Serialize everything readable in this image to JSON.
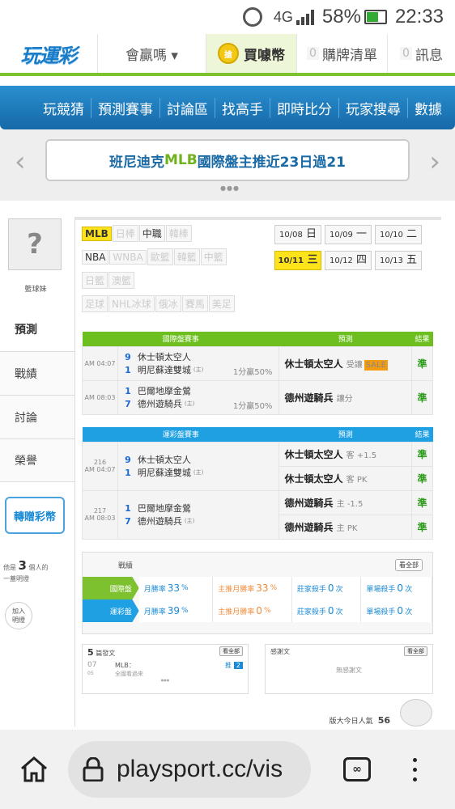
{
  "status": {
    "battery": "58%",
    "time": "22:33",
    "network": "4G"
  },
  "nav": {
    "logo": "玩運彩",
    "user_menu": "會贏嗎 ▾",
    "buy": "買噱幣",
    "coin_icon": "搶",
    "buy_list_count": "0",
    "buy_list": "購牌清單",
    "msg_count": "0",
    "messages": "訊息"
  },
  "main_nav": [
    "玩競猜",
    "預測賽事",
    "討論區",
    "找高手",
    "即時比分",
    "玩家搜尋",
    "數據"
  ],
  "carousel": {
    "left_arrow": "‹",
    "right_arrow": "›",
    "text_a": "班尼迪克 ",
    "text_b": "MLB",
    "text_c": " 國際盤主推近23日過21",
    "dots": "●●●"
  },
  "profile": {
    "avatar_mark": "?",
    "username": "籃球妹"
  },
  "side_tabs": [
    "預測",
    "戰績",
    "討論",
    "榮譽"
  ],
  "gift_button": "轉贈彩幣",
  "fans": {
    "pre": "他是",
    "count": "3",
    "post": "個人的",
    "line2": "一蓋明燈"
  },
  "follow": {
    "line1": "加入",
    "line2": "明燈"
  },
  "sports": [
    {
      "label": "MLB",
      "state": "on"
    },
    {
      "label": "日棒",
      "state": "dim"
    },
    {
      "label": "中職",
      "state": "norm"
    },
    {
      "label": "韓棒",
      "state": "dim"
    },
    {
      "label": "NBA",
      "state": "norm"
    },
    {
      "label": "WNBA",
      "state": "dim"
    },
    {
      "label": "歐籃",
      "state": "dim"
    },
    {
      "label": "韓籃",
      "state": "dim"
    },
    {
      "label": "中籃",
      "state": "dim"
    },
    {
      "label": "日籃",
      "state": "dim"
    },
    {
      "label": "澳籃",
      "state": "dim"
    },
    {
      "label": "足球",
      "state": "dim"
    },
    {
      "label": "NHL冰球",
      "state": "dim"
    },
    {
      "label": "俄冰",
      "state": "dim"
    },
    {
      "label": "賽馬",
      "state": "dim"
    },
    {
      "label": "美足",
      "state": "dim"
    }
  ],
  "dates": [
    {
      "d": "10/08",
      "w": "日",
      "on": false
    },
    {
      "d": "10/09",
      "w": "一",
      "on": false
    },
    {
      "d": "10/10",
      "w": "二",
      "on": false
    },
    {
      "d": "10/11",
      "w": "三",
      "on": true
    },
    {
      "d": "10/12",
      "w": "四",
      "on": false
    },
    {
      "d": "10/13",
      "w": "五",
      "on": false
    }
  ],
  "intl_table": {
    "headers": [
      "國際盤賽事",
      "預測",
      "結果"
    ],
    "rows": [
      {
        "time": "AM 04:07",
        "n1": "9",
        "t1": "休士頓太空人",
        "n2": "1",
        "t2": "明尼蘇達雙城",
        "host": "(主)",
        "odds": "1分贏50%",
        "pick": "休士頓太空人",
        "type": "受讓",
        "badge": "SALE",
        "result": "準"
      },
      {
        "time": "AM 08:03",
        "n1": "1",
        "t1": "巴爾地摩金鶯",
        "n2": "7",
        "t2": "德州遊騎兵",
        "host": "(主)",
        "odds": "1分贏50%",
        "pick": "德州遊騎兵",
        "type": "讓分",
        "badge": "",
        "result": "準"
      }
    ]
  },
  "lottery_table": {
    "headers": [
      "運彩盤賽事",
      "預測",
      "結果"
    ],
    "games": [
      {
        "id": "216",
        "time": "AM 04:07",
        "n1": "9",
        "t1": "休士頓太空人",
        "n2": "1",
        "t2": "明尼蘇達雙城",
        "host": "(主)",
        "picks": [
          {
            "team": "休士頓太空人",
            "type": "客 +1.5",
            "result": "準"
          },
          {
            "team": "休士頓太空人",
            "type": "客 PK",
            "result": "準"
          }
        ]
      },
      {
        "id": "217",
        "time": "AM 08:03",
        "n1": "1",
        "t1": "巴爾地摩金鶯",
        "n2": "7",
        "t2": "德州遊騎兵",
        "host": "(主)",
        "picks": [
          {
            "team": "德州遊騎兵",
            "type": "主 -1.5",
            "result": "準"
          },
          {
            "team": "德州遊騎兵",
            "type": "主 PK",
            "result": "準"
          }
        ]
      }
    ]
  },
  "stats": {
    "title": "戰績",
    "all": "看全部",
    "rows": [
      {
        "label": "國際盤",
        "color": "#7ec12f",
        "month": "月勝率",
        "month_v": "33",
        "host": "主推月勝率",
        "host_v": "33",
        "banker": "莊家殺手",
        "banker_v": "0",
        "single": "單場殺手",
        "single_v": "0"
      },
      {
        "label": "運彩盤",
        "color": "#1fa0e3",
        "month": "月勝率",
        "month_v": "39",
        "host": "主推月勝率",
        "host_v": "0",
        "banker": "莊家殺手",
        "banker_v": "0",
        "single": "單場殺手",
        "single_v": "0"
      }
    ],
    "pct": "%",
    "times": "次"
  },
  "articles": {
    "count": "5",
    "label": "篇發文",
    "all": "看全部",
    "date": "07",
    "date2": "05",
    "title": "MLB：",
    "sub": "全國看過來",
    "tag_pre": "推",
    "tag": "2",
    "dots": "●●●"
  },
  "gratitude": {
    "label": "感謝文",
    "all": "看全部",
    "empty": "無感謝文"
  },
  "popularity": {
    "label": "版大今日人氣",
    "value": "56"
  },
  "browser": {
    "url": "playsport.cc/vis",
    "tabs": "∞"
  }
}
